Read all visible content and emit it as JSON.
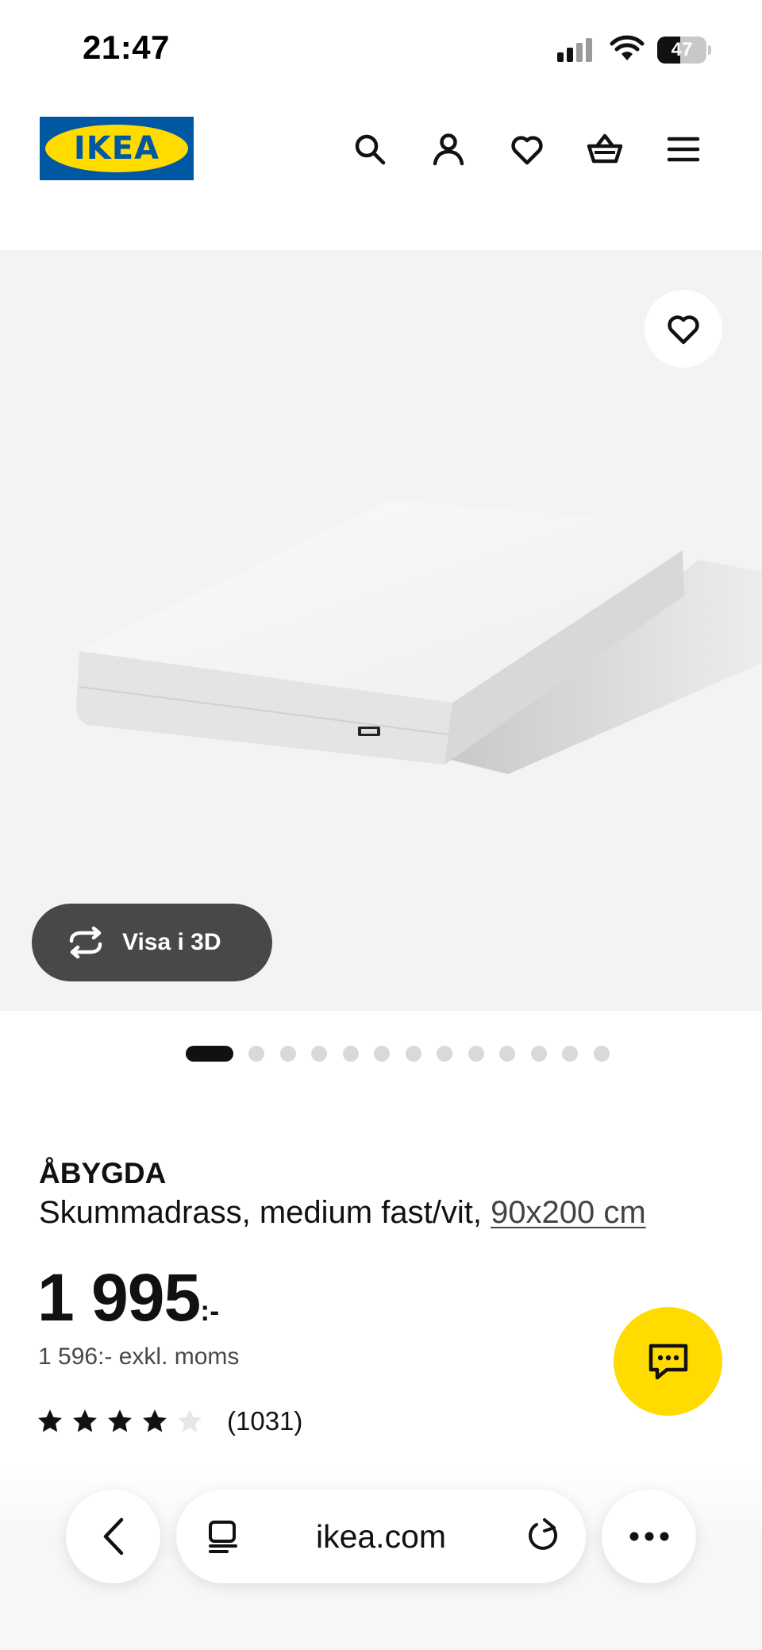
{
  "status_bar": {
    "time": "21:47",
    "battery_level": "47",
    "icons": [
      "signal-icon",
      "wifi-icon",
      "battery-icon"
    ]
  },
  "header": {
    "logo_text": "IKEA",
    "brand_colors": {
      "blue": "#0058a3",
      "yellow": "#ffdb00"
    },
    "icons": [
      "search-icon",
      "account-icon",
      "heart-icon",
      "basket-icon",
      "menu-icon"
    ]
  },
  "gallery": {
    "view_3d_label": "Visa i 3D",
    "image_count": 13,
    "active_index": 0
  },
  "product": {
    "name": "ÅBYGDA",
    "description": "Skummadrass, medium fast/vit,",
    "size": "90x200 cm",
    "price": "1 995",
    "price_suffix": ":-",
    "price_ex_vat": "1 596:- exkl. moms",
    "rating": 4,
    "rating_max": 5,
    "review_count": "(1031)"
  },
  "browser": {
    "url": "ikea.com",
    "icons": [
      "back-icon",
      "reader-icon",
      "reload-icon",
      "more-icon"
    ]
  }
}
